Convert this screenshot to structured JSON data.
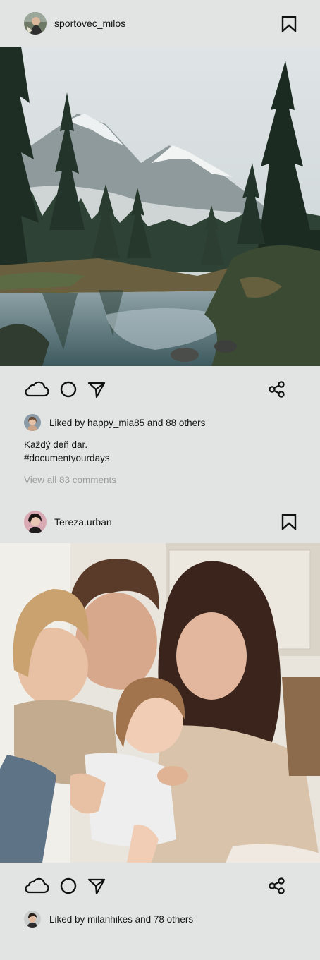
{
  "posts": [
    {
      "username": "sportovec_milos",
      "avatar_icon": "person-avatar",
      "image_alt": "mountain lake with pine forest",
      "actions": [
        "cloud-icon",
        "circle-icon",
        "send-icon",
        "share-icon"
      ],
      "liked_by_prefix": "Liked by ",
      "liked_by_user": "happy_mia85",
      "liked_by_suffix": " and 88 others",
      "caption_line1": "Každý deň dar.",
      "caption_line2": "#documentyourdays",
      "view_comments": "View all 83 comments"
    },
    {
      "username": "Tereza.urban",
      "avatar_icon": "person-avatar",
      "image_alt": "family hugging on a sofa",
      "actions": [
        "cloud-icon",
        "circle-icon",
        "send-icon",
        "share-icon"
      ],
      "liked_by_prefix": "Liked by ",
      "liked_by_user": "milanhikes",
      "liked_by_suffix": " and 78 others"
    }
  ],
  "colors": {
    "background": "#e2e4e3",
    "text": "#111111",
    "muted": "#9a9c9b"
  }
}
